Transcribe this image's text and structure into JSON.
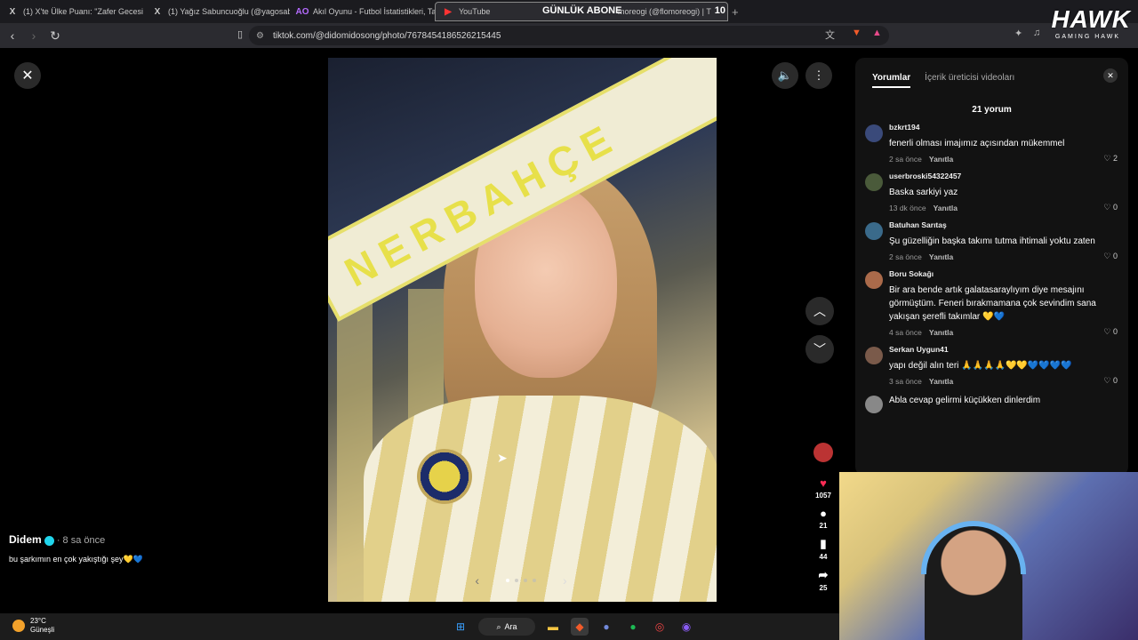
{
  "browser": {
    "tabs": [
      {
        "icon": "X",
        "title": "(1) X'te Ülke Puanı: \"Zafer Gecesi Fen"
      },
      {
        "icon": "X",
        "title": "(1) Yağız Sabuncuoğlu (@yagosabun"
      },
      {
        "icon": "AO",
        "title": "Akıl Oyunu - Futbol İstatistikleri, Tahn"
      },
      {
        "icon": "▶",
        "title": "YouTube",
        "title_suffix": "moreogi (@flomoreogi) | T"
      }
    ],
    "overlay_label": "GÜNLÜK ABONE",
    "overlay_count": "10",
    "url": "tiktok.com/@didomidosong/photo/7678454186526215445",
    "plus": "+"
  },
  "brand": {
    "name": "HAWK",
    "sub": "GAMING HAWK"
  },
  "post": {
    "author": "Didem",
    "time": "· 8 sa önce",
    "caption": "bu şarkımın en çok yakıştığı şey💛💙",
    "scarf_text": "NERBAHÇE",
    "likes": "1057",
    "comments_count": "21",
    "saves": "44",
    "shares": "25"
  },
  "panel": {
    "tab_comments": "Yorumlar",
    "tab_creator": "İçerik üreticisi videoları",
    "count_label": "21 yorum",
    "reply_label": "Yanıtla",
    "comments": [
      {
        "user": "bzkrt194",
        "text": "fenerli olması imajımız açısından mükemmel",
        "time": "2 sa önce",
        "likes": "2",
        "avatar_color": "#3a4a7a"
      },
      {
        "user": "userbroski54322457",
        "text": "Baska sarkiyi yaz",
        "time": "13 dk önce",
        "likes": "0",
        "avatar_color": "#4a5a3a"
      },
      {
        "user": "Batuhan Sarıtaş",
        "text": "Şu güzelliğin başka takımı tutma ihtimali yoktu zaten",
        "time": "2 sa önce",
        "likes": "0",
        "avatar_color": "#3a6a8a"
      },
      {
        "user": "Boru Sokağı",
        "text": "Bir ara bende artık galatasaraylıyım diye mesajını görmüştüm. Feneri bırakmamana çok sevindim sana yakışan şerefli takımlar 💛💙",
        "time": "4 sa önce",
        "likes": "0",
        "avatar_color": "#aa6a4a"
      },
      {
        "user": "Serkan Uygun41",
        "text": "yapı değil alın teri 🙏🙏🙏🙏💛💛💙💙💙💙",
        "time": "3 sa önce",
        "likes": "0",
        "avatar_color": "#7a5a4a"
      },
      {
        "user": "",
        "text": "Abla cevap gelirmi küçükken dinlerdim",
        "time": "",
        "likes": "",
        "avatar_color": "#888888"
      }
    ]
  },
  "taskbar": {
    "temp": "23°C",
    "condition": "Güneşli",
    "search": "Ara"
  }
}
